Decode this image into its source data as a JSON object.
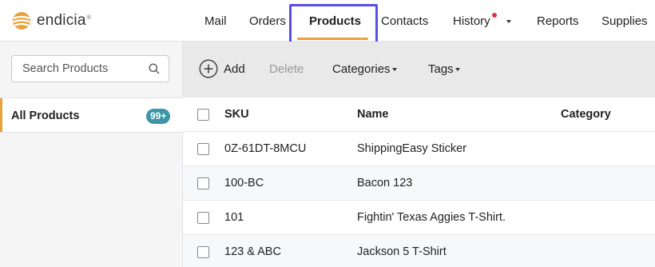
{
  "brand": {
    "name": "endicia",
    "trademark": "®",
    "accent_color": "#e8a23c",
    "highlight_color": "#5b4de8"
  },
  "nav": {
    "items": [
      {
        "label": "Mail"
      },
      {
        "label": "Orders"
      },
      {
        "label": "Products",
        "active": true
      },
      {
        "label": "Contacts"
      },
      {
        "label": "History",
        "has_notification": true,
        "has_dropdown": true
      },
      {
        "label": "Reports"
      },
      {
        "label": "Supplies"
      }
    ]
  },
  "sidebar": {
    "search": {
      "placeholder": "Search Products",
      "value": ""
    },
    "all_products": {
      "label": "All Products",
      "count": "99+"
    },
    "badge_color": "#3d95a8"
  },
  "toolbar": {
    "add_label": "Add",
    "delete_label": "Delete",
    "categories_label": "Categories",
    "tags_label": "Tags"
  },
  "table": {
    "columns": [
      "SKU",
      "Name",
      "Category"
    ],
    "rows": [
      {
        "sku": "0Z-61DT-8MCU",
        "name": "ShippingEasy Sticker",
        "category": ""
      },
      {
        "sku": "100-BC",
        "name": "Bacon 123",
        "category": ""
      },
      {
        "sku": "101",
        "name": "Fightin' Texas Aggies T-Shirt.",
        "category": ""
      },
      {
        "sku": "123 & ABC",
        "name": "Jackson 5 T-Shirt",
        "category": ""
      }
    ]
  }
}
